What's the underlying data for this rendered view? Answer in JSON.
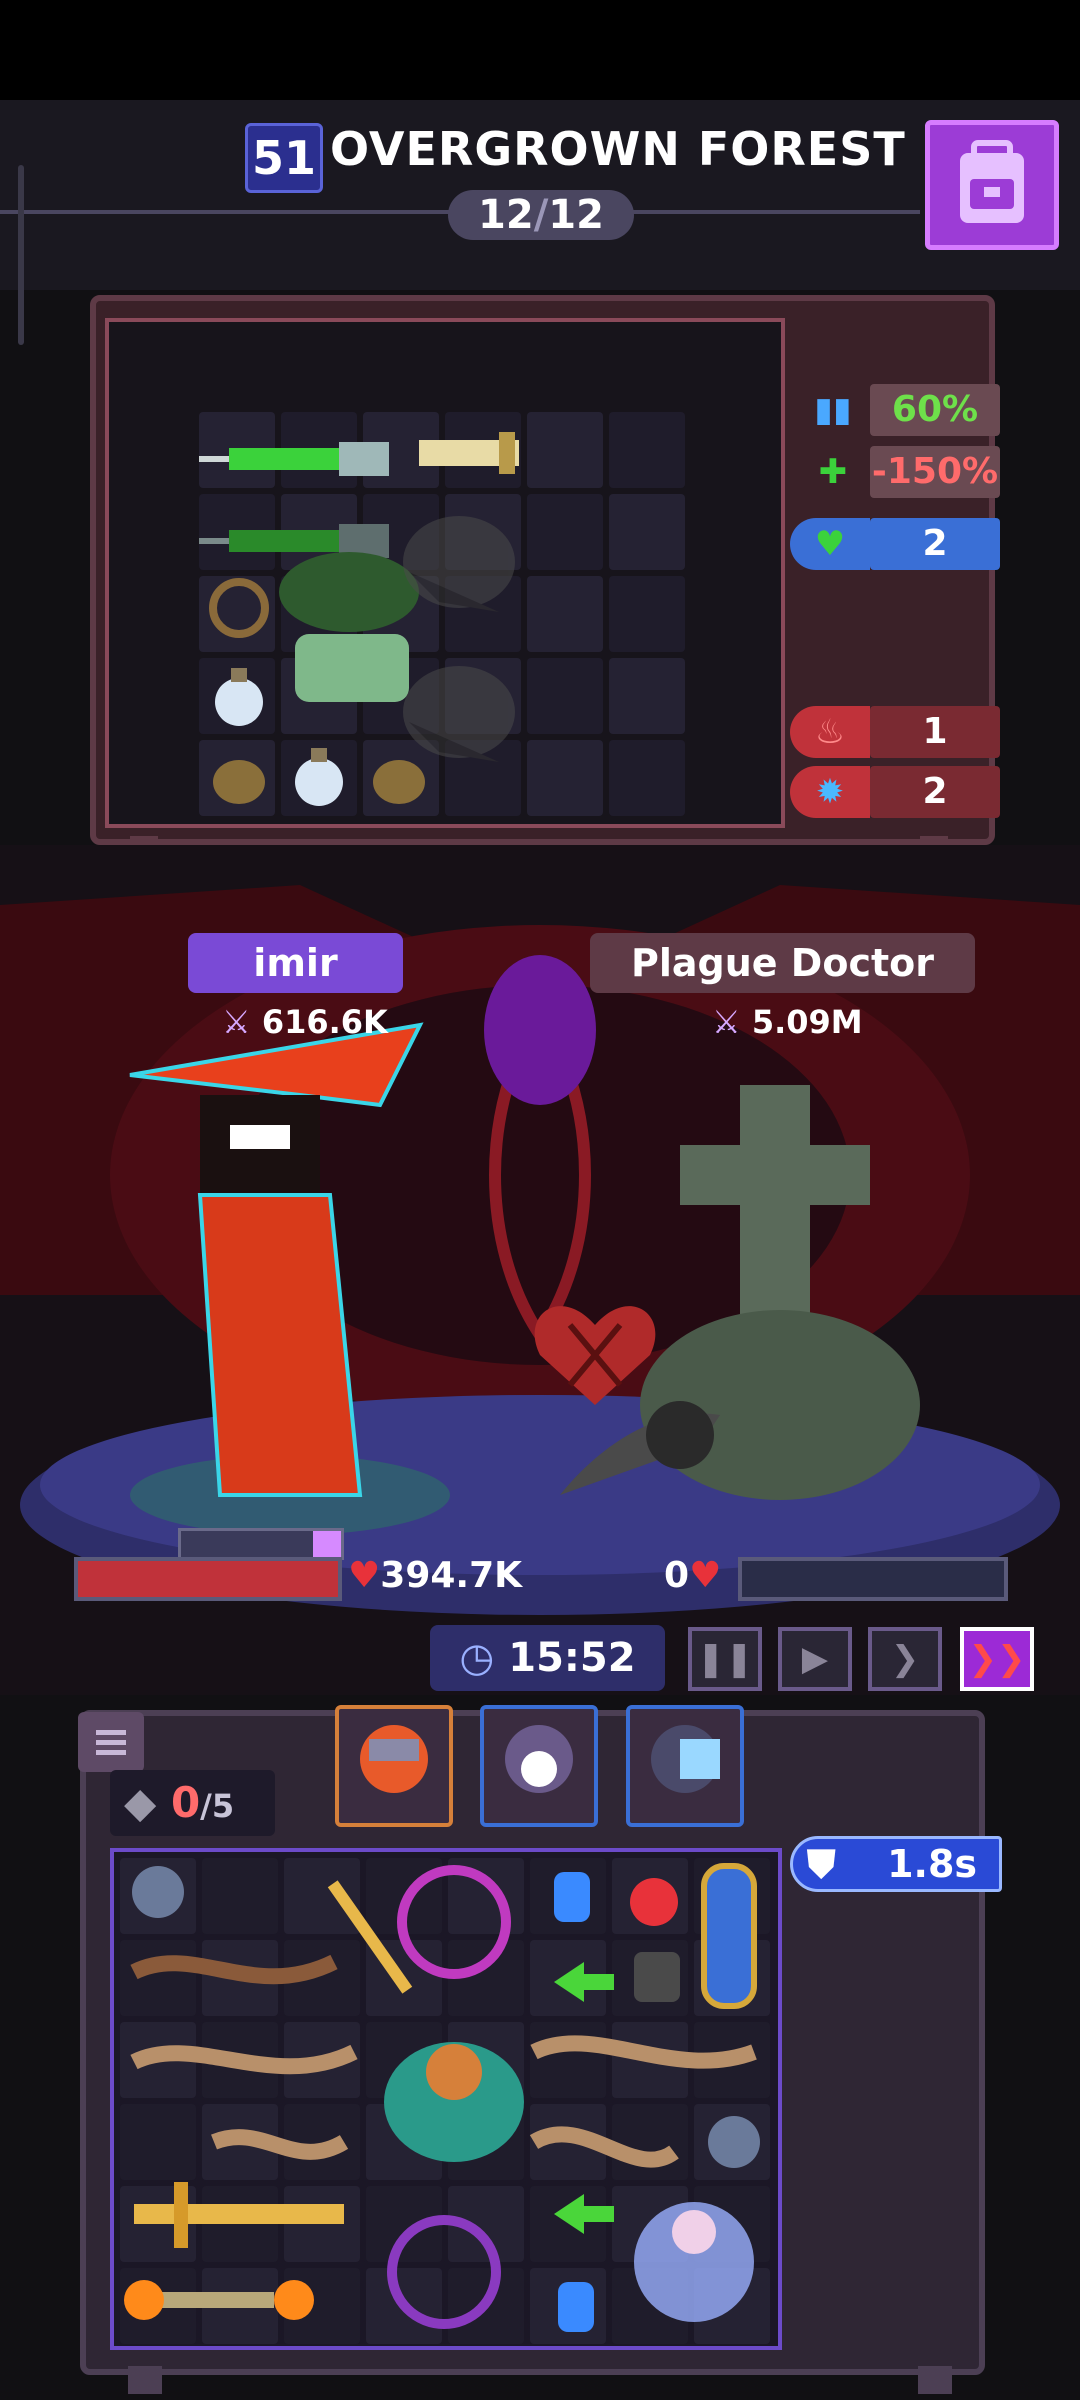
{
  "header": {
    "stage_number": "51",
    "stage_name": "OVERGROWN FOREST",
    "wave_current": "12",
    "wave_total": "12",
    "bag_icon": "backpack-icon"
  },
  "enemy_stats": [
    {
      "icon": "multi-bar-icon",
      "value": "60%",
      "color": "#6ee04a"
    },
    {
      "icon": "no-heal-icon",
      "value": "-150%",
      "color": "#ff6b6b"
    },
    {
      "icon": "heart-shield-icon",
      "value": "2",
      "color": "#ffffff"
    },
    {
      "icon": "burn-icon",
      "value": "1",
      "color": "#ffffff"
    },
    {
      "icon": "gear-icon",
      "value": "2",
      "color": "#ffffff"
    }
  ],
  "player": {
    "name": "imir",
    "power": "616.6K",
    "hp": "394.7K"
  },
  "enemy": {
    "name": "Plague Doctor",
    "power": "5.09M",
    "hp": "0"
  },
  "timer": "15:52",
  "controls": [
    "pause-icon",
    "play-icon",
    "fast-forward-icon",
    "double-speed-icon"
  ],
  "inventory": {
    "slots_used": "0",
    "slots_total": "/5",
    "cooldown": "1.8s"
  },
  "colors": {
    "accent_purple": "#9c3cd6",
    "hp_red": "#c0323a",
    "stat_green": "#6ee04a",
    "stat_red": "#ff6b6b",
    "stat_blue": "#3a6fd6"
  }
}
